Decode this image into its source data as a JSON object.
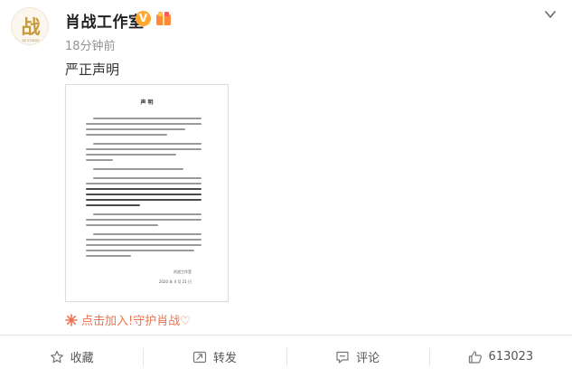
{
  "post": {
    "author": {
      "name": "肖战工作室",
      "verified_icon": "verified-badge-icon",
      "member_badge_icon": "member-badge-icon",
      "avatar_text": "战",
      "avatar_subtext": "XZ STUDIO"
    },
    "time": "18分钟前",
    "text": "严正声明",
    "document": {
      "title": "声 明",
      "signature": "肖战工作室",
      "date": "2020 年 4 月 21 日"
    },
    "topic_link": {
      "icon": "spark-icon",
      "text": "点击加入!守护肖战♡"
    }
  },
  "actions": {
    "favorite": {
      "icon": "star-icon",
      "label": "收藏"
    },
    "repost": {
      "icon": "repost-icon",
      "label": "转发"
    },
    "comment": {
      "icon": "comment-icon",
      "label": "评论"
    },
    "like": {
      "icon": "thumbs-up-icon",
      "label": "613023"
    }
  },
  "colors": {
    "accent_orange": "#eb7350",
    "verified": "#ffa72e",
    "avatar_gold": "#c79a3c",
    "muted_text": "#939393"
  }
}
